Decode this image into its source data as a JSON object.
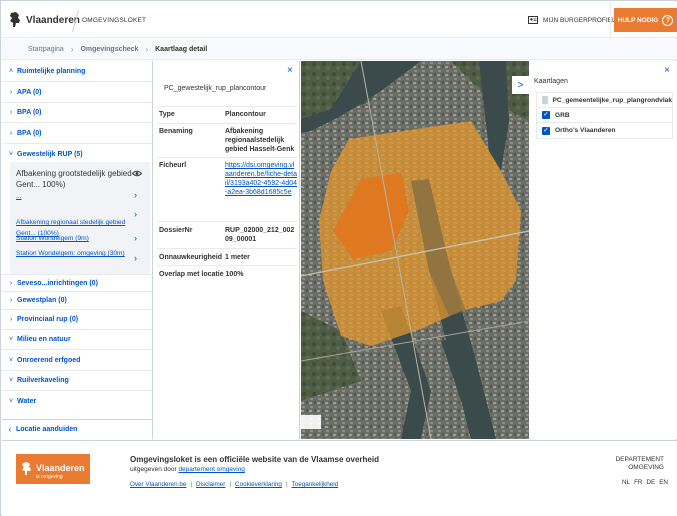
{
  "header": {
    "brand": "Vlaanderen",
    "product": "OMGEVINGSLOKET",
    "profile_label": "MIJN BURGERPROFIEL",
    "help_label": "HULP NODIG",
    "help_icon": "?"
  },
  "breadcrumb": {
    "items": [
      "Startpagina",
      "Omgevingscheck",
      "Kaartlaag detail"
    ]
  },
  "sidebar": {
    "sections": [
      {
        "icon": "^",
        "label": "Ruimtelijke planning"
      },
      {
        "icon": ">",
        "label": "APA (0)"
      },
      {
        "icon": ">",
        "label": "BPA (0)"
      },
      {
        "icon": ">",
        "label": "BPA (0)"
      },
      {
        "icon": "v",
        "label": "Gewestelijk RUP (5)"
      },
      {
        "icon": ">",
        "label": "Seveso...inrichtingen (0)"
      },
      {
        "icon": ">",
        "label": "Gewestplan (0)"
      },
      {
        "icon": ">",
        "label": "Provinciaal rup (0)"
      },
      {
        "icon": "v",
        "label": "Milieu en natuur"
      },
      {
        "icon": "v",
        "label": "Onroerend erfgoed"
      },
      {
        "icon": "v",
        "label": "Ruilverkaveling"
      },
      {
        "icon": "v",
        "label": "Water"
      }
    ],
    "rup": {
      "selected": "Afbakening grootstedelijk gebied Gent... 100%)",
      "items": [
        "...",
        "Afbakening regionaal stedelijk gebied Gent... (100%)",
        "Station Wondelgem (9m)",
        "Station Wondelgem: omgeving (30m)"
      ]
    },
    "back_label": "Locatie aanduiden"
  },
  "detail": {
    "title": "PC_gewestelijk_rup_plancontour",
    "close": "×",
    "rows": [
      {
        "key": "Type",
        "value": "Plancontour"
      },
      {
        "key": "Benaming",
        "value": "Afbakening regionaalstedelijk gebied Hasselt-Genk"
      },
      {
        "key": "Ficheurl",
        "value": "https://dsi.omgeving.vlaanderen.be/fiche-detail/3193a402-4592-4d04-a2ea-3b68d1685c5e"
      },
      {
        "key": "DossierNr",
        "value": "RUP_02000_212_00209_00001"
      },
      {
        "key": "Onnauwkeurigheid",
        "value": "1 meter"
      }
    ],
    "overlap": "Overlap met locatie 100%"
  },
  "map": {
    "toggle": ">"
  },
  "layers": {
    "title": "Kaartlagen",
    "close": "×",
    "items": [
      {
        "label": "PC_gemeentelijke_rup_plangrondvlak",
        "checked": false
      },
      {
        "label": "GRB",
        "checked": true
      },
      {
        "label": "Ortho's Vlaanderen",
        "checked": true
      }
    ]
  },
  "footer": {
    "logo_text": "Vlaanderen",
    "logo_sub": "is omgeving",
    "title": "Omgevingsloket is een officiële website van de Vlaamse overheid",
    "sub_prefix": "uitgegeven door ",
    "sub_link": "departement omgeving",
    "links": [
      "Over Vlaanderen.be",
      "Disclaimer",
      "Cookieverklaring",
      "Toegankelijkheid"
    ],
    "link_sep": "|",
    "dept_line1": "DEPARTEMENT",
    "dept_line2": "OMGEVING",
    "languages": [
      "NL",
      "FR",
      "DE",
      "EN"
    ]
  },
  "colors": {
    "brand_orange": "#ea7b32",
    "link_blue": "#0055cc",
    "zone_orange": "#e89a2c",
    "zone_dark": "#e07820"
  }
}
